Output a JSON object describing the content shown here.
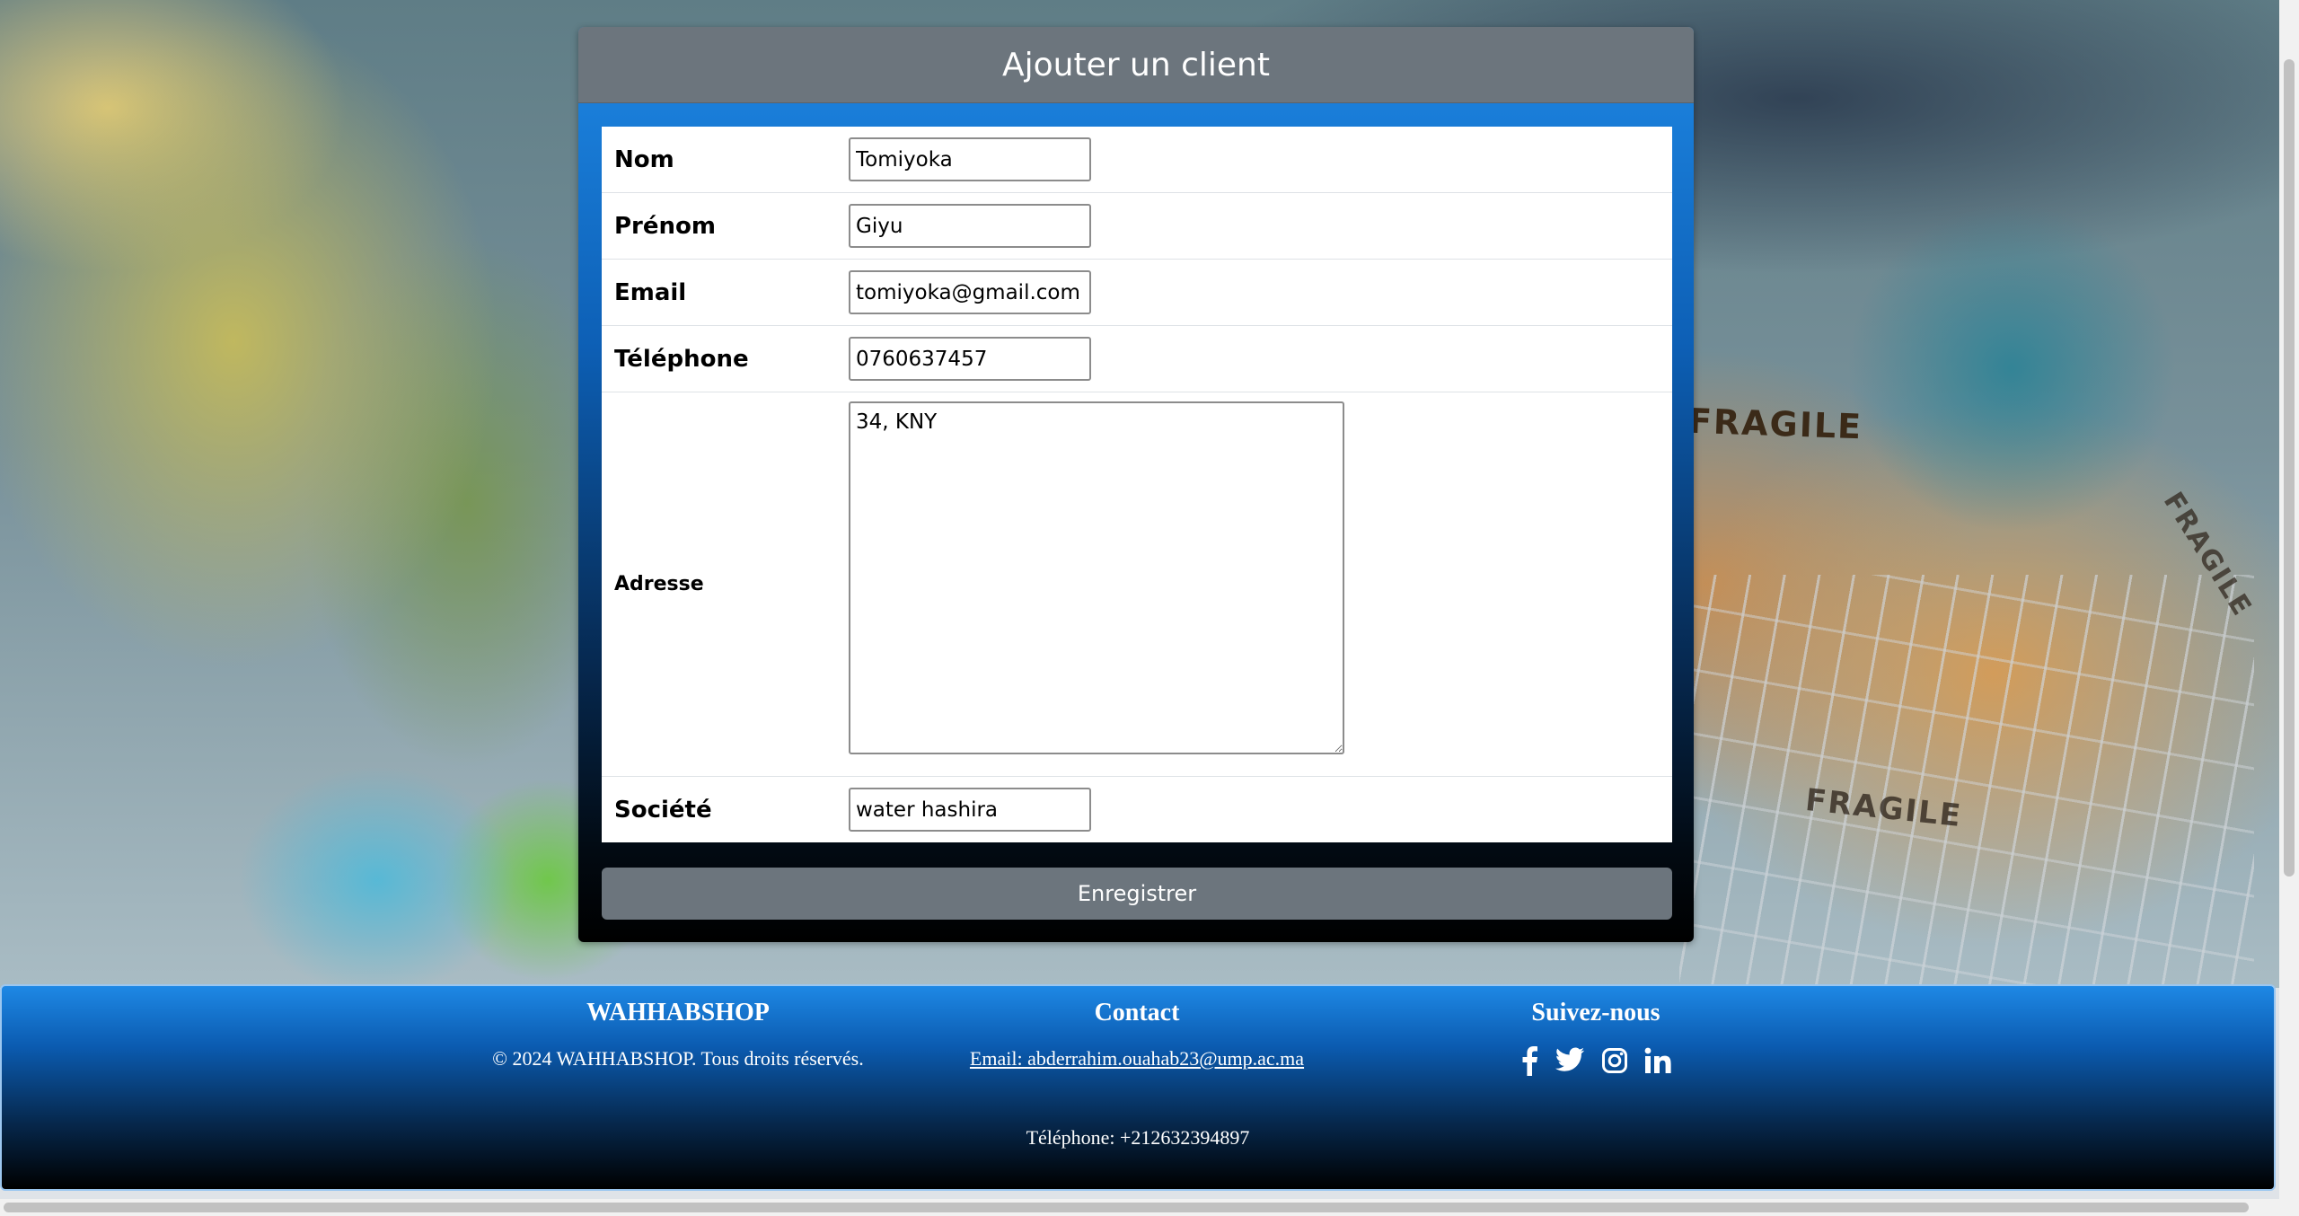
{
  "form": {
    "title": "Ajouter un client",
    "fields": [
      {
        "label": "Nom",
        "value": "Tomiyoka"
      },
      {
        "label": "Prénom",
        "value": "Giyu"
      },
      {
        "label": "Email",
        "value": "tomiyoka@gmail.com"
      },
      {
        "label": "Téléphone",
        "value": "0760637457"
      },
      {
        "label": "Adresse",
        "value": "34, KNY"
      },
      {
        "label": "Société",
        "value": "water hashira"
      }
    ],
    "submit_label": "Enregistrer",
    "accent_gradient_top": "#1e88e5",
    "button_color": "#6c757d"
  },
  "background": {
    "box_labels": [
      "FRAGILE",
      "FRAGILE",
      "FRAGILE"
    ]
  },
  "footer": {
    "brand": {
      "heading": "WAHHABSHOP",
      "copyright": "© 2024 WAHHABSHOP. Tous droits réservés."
    },
    "contact": {
      "heading": "Contact",
      "email": "Email: abderrahim.ouahab23@ump.ac.ma",
      "phone": "Téléphone: +212632394897"
    },
    "follow": {
      "heading": "Suivez-nous",
      "icons": [
        "facebook-icon",
        "twitter-icon",
        "instagram-icon",
        "linkedin-icon"
      ]
    }
  }
}
